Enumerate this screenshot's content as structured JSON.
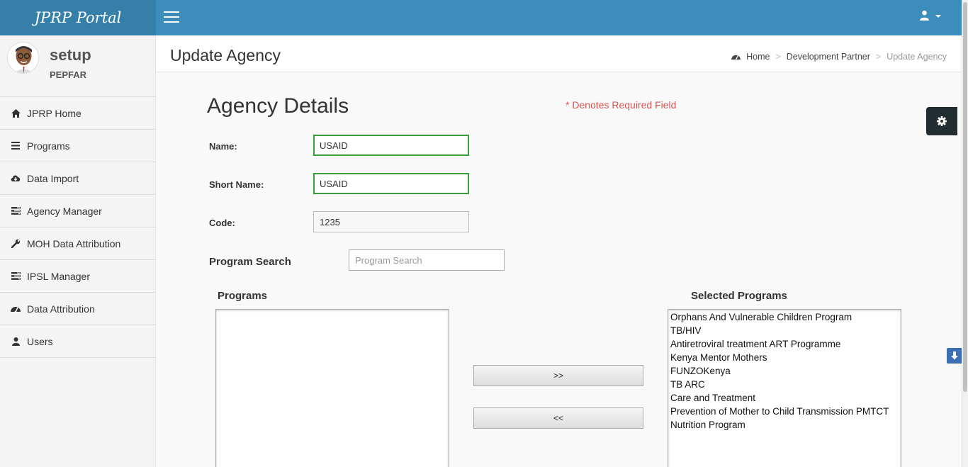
{
  "brand": "JPRP Portal",
  "user": {
    "name": "setup",
    "org": "PEPFAR"
  },
  "sidebar": {
    "items": [
      {
        "label": "JPRP Home",
        "icon": "home-icon"
      },
      {
        "label": "Programs",
        "icon": "list-icon"
      },
      {
        "label": "Data Import",
        "icon": "cloud-download-icon"
      },
      {
        "label": "Agency Manager",
        "icon": "tasks-icon"
      },
      {
        "label": "MOH Data Attribution",
        "icon": "wrench-icon"
      },
      {
        "label": "IPSL Manager",
        "icon": "tasks-icon"
      },
      {
        "label": "Data Attribution",
        "icon": "dashboard-icon"
      },
      {
        "label": "Users",
        "icon": "user-icon"
      }
    ]
  },
  "header": {
    "title": "Update Agency"
  },
  "breadcrumb": {
    "home": "Home",
    "parent": "Development Partner",
    "current": "Update Agency",
    "separator": ">"
  },
  "form": {
    "title": "Agency Details",
    "required_note": "* Denotes Required Field",
    "name_label": "Name:",
    "name_value": "USAID",
    "short_name_label": "Short Name:",
    "short_name_value": "USAID",
    "code_label": "Code:",
    "code_value": "1235",
    "search_label": "Program Search",
    "search_placeholder": "Program Search",
    "programs_label": "Programs",
    "selected_label": "Selected Programs",
    "add_button": ">>",
    "remove_button": "<<",
    "selected_programs": [
      "Orphans And Vulnerable Children Program",
      "TB/HIV",
      "Antiretroviral treatment ART Programme",
      "Kenya Mentor Mothers",
      "FUNZOKenya",
      "TB ARC",
      "Care and Treatment",
      "Prevention of Mother to Child Transmission PMTCT",
      "Nutrition Program"
    ]
  },
  "colors": {
    "topbar": "#3c8dbc",
    "brand_bg": "#367fa9",
    "required": "#d9534f",
    "valid_border": "#3c9c3c"
  }
}
